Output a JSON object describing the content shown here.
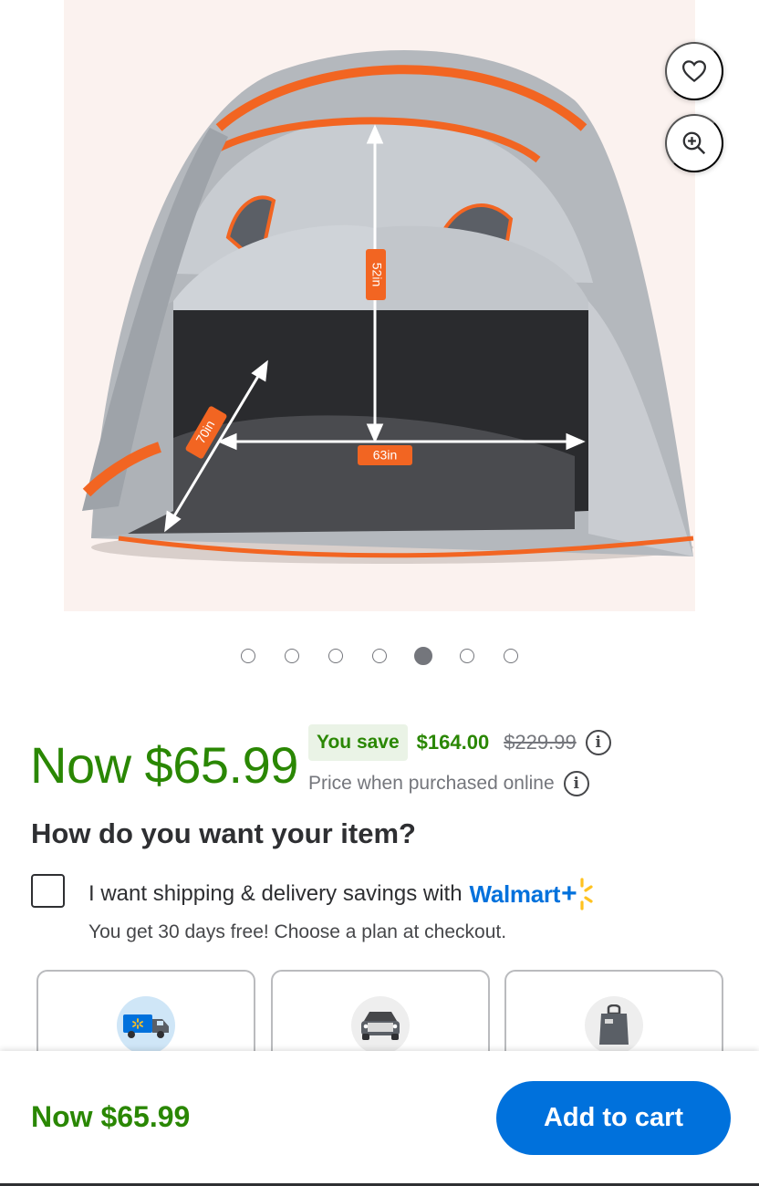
{
  "product_image": {
    "alt": "Truck bed tent with dimensions",
    "dimension_labels": {
      "height": "52in",
      "width": "63in",
      "length": "70in"
    },
    "dot_count": 7,
    "active_dot": 5
  },
  "price": {
    "now": "Now $65.99",
    "save_badge": "You save",
    "save_amount": "$164.00",
    "was": "$229.99",
    "online_note": "Price when purchased online",
    "info_glyph": "i"
  },
  "fulfillment": {
    "heading": "How do you want your item?",
    "shipping_savings_text": "I want shipping & delivery savings with",
    "walmart_plus": "Walmart",
    "walmart_plus_sign": "+",
    "free_trial_note": "You get 30 days free! Choose a plan at checkout.",
    "options": [
      {
        "icon": "delivery-truck-icon"
      },
      {
        "icon": "pickup-car-icon"
      },
      {
        "icon": "shopping-bag-icon"
      }
    ]
  },
  "bottom_bar": {
    "price": "Now $65.99",
    "add_to_cart": "Add to cart"
  },
  "colors": {
    "price_green": "#2a8703",
    "walmart_blue": "#0071dc",
    "spark_yellow": "#ffc220",
    "tent_orange": "#f26522"
  }
}
